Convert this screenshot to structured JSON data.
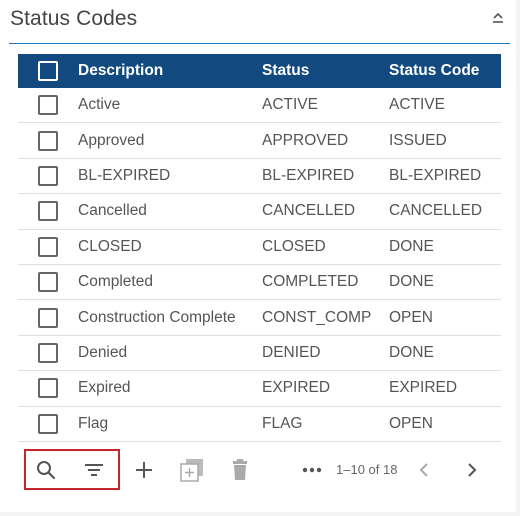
{
  "panel": {
    "title": "Status Codes"
  },
  "grid": {
    "columns": [
      "Description",
      "Status",
      "Status Code"
    ],
    "rows": [
      {
        "description": "Active",
        "status": "ACTIVE",
        "code": "ACTIVE"
      },
      {
        "description": "Approved",
        "status": "APPROVED",
        "code": "ISSUED"
      },
      {
        "description": "BL-EXPIRED",
        "status": "BL-EXPIRED",
        "code": "BL-EXPIRED"
      },
      {
        "description": "Cancelled",
        "status": "CANCELLED",
        "code": "CANCELLED"
      },
      {
        "description": "CLOSED",
        "status": "CLOSED",
        "code": "DONE"
      },
      {
        "description": "Completed",
        "status": "COMPLETED",
        "code": "DONE"
      },
      {
        "description": "Construction Complete",
        "status": "CONST_COMP",
        "code": "OPEN"
      },
      {
        "description": "Denied",
        "status": "DENIED",
        "code": "DONE"
      },
      {
        "description": "Expired",
        "status": "EXPIRED",
        "code": "EXPIRED"
      },
      {
        "description": "Flag",
        "status": "FLAG",
        "code": "OPEN"
      }
    ]
  },
  "toolbar": {
    "icons": [
      "search-icon",
      "filter-icon",
      "add-icon",
      "copy-icon",
      "delete-icon",
      "more-icon",
      "chevron-left-icon",
      "chevron-right-icon"
    ],
    "pagination": "1–10 of 18"
  },
  "colors": {
    "header_bg": "#124a80",
    "accent_rule": "#1e73be",
    "highlight_border": "#c0282b"
  }
}
